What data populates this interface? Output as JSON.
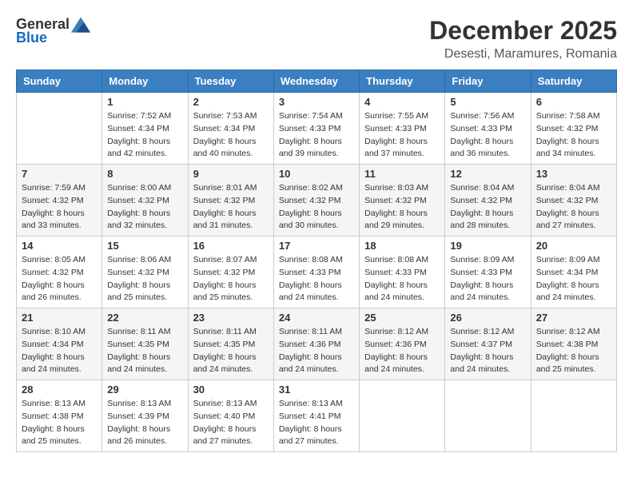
{
  "logo": {
    "text_general": "General",
    "text_blue": "Blue"
  },
  "title": "December 2025",
  "subtitle": "Desesti, Maramures, Romania",
  "header_color": "#3a7fc1",
  "days_of_week": [
    "Sunday",
    "Monday",
    "Tuesday",
    "Wednesday",
    "Thursday",
    "Friday",
    "Saturday"
  ],
  "weeks": [
    [
      {
        "day": "",
        "sunrise": "",
        "sunset": "",
        "daylight": ""
      },
      {
        "day": "1",
        "sunrise": "7:52 AM",
        "sunset": "4:34 PM",
        "daylight": "8 hours and 42 minutes."
      },
      {
        "day": "2",
        "sunrise": "7:53 AM",
        "sunset": "4:34 PM",
        "daylight": "8 hours and 40 minutes."
      },
      {
        "day": "3",
        "sunrise": "7:54 AM",
        "sunset": "4:33 PM",
        "daylight": "8 hours and 39 minutes."
      },
      {
        "day": "4",
        "sunrise": "7:55 AM",
        "sunset": "4:33 PM",
        "daylight": "8 hours and 37 minutes."
      },
      {
        "day": "5",
        "sunrise": "7:56 AM",
        "sunset": "4:33 PM",
        "daylight": "8 hours and 36 minutes."
      },
      {
        "day": "6",
        "sunrise": "7:58 AM",
        "sunset": "4:32 PM",
        "daylight": "8 hours and 34 minutes."
      }
    ],
    [
      {
        "day": "7",
        "sunrise": "7:59 AM",
        "sunset": "4:32 PM",
        "daylight": "8 hours and 33 minutes."
      },
      {
        "day": "8",
        "sunrise": "8:00 AM",
        "sunset": "4:32 PM",
        "daylight": "8 hours and 32 minutes."
      },
      {
        "day": "9",
        "sunrise": "8:01 AM",
        "sunset": "4:32 PM",
        "daylight": "8 hours and 31 minutes."
      },
      {
        "day": "10",
        "sunrise": "8:02 AM",
        "sunset": "4:32 PM",
        "daylight": "8 hours and 30 minutes."
      },
      {
        "day": "11",
        "sunrise": "8:03 AM",
        "sunset": "4:32 PM",
        "daylight": "8 hours and 29 minutes."
      },
      {
        "day": "12",
        "sunrise": "8:04 AM",
        "sunset": "4:32 PM",
        "daylight": "8 hours and 28 minutes."
      },
      {
        "day": "13",
        "sunrise": "8:04 AM",
        "sunset": "4:32 PM",
        "daylight": "8 hours and 27 minutes."
      }
    ],
    [
      {
        "day": "14",
        "sunrise": "8:05 AM",
        "sunset": "4:32 PM",
        "daylight": "8 hours and 26 minutes."
      },
      {
        "day": "15",
        "sunrise": "8:06 AM",
        "sunset": "4:32 PM",
        "daylight": "8 hours and 25 minutes."
      },
      {
        "day": "16",
        "sunrise": "8:07 AM",
        "sunset": "4:32 PM",
        "daylight": "8 hours and 25 minutes."
      },
      {
        "day": "17",
        "sunrise": "8:08 AM",
        "sunset": "4:33 PM",
        "daylight": "8 hours and 24 minutes."
      },
      {
        "day": "18",
        "sunrise": "8:08 AM",
        "sunset": "4:33 PM",
        "daylight": "8 hours and 24 minutes."
      },
      {
        "day": "19",
        "sunrise": "8:09 AM",
        "sunset": "4:33 PM",
        "daylight": "8 hours and 24 minutes."
      },
      {
        "day": "20",
        "sunrise": "8:09 AM",
        "sunset": "4:34 PM",
        "daylight": "8 hours and 24 minutes."
      }
    ],
    [
      {
        "day": "21",
        "sunrise": "8:10 AM",
        "sunset": "4:34 PM",
        "daylight": "8 hours and 24 minutes."
      },
      {
        "day": "22",
        "sunrise": "8:11 AM",
        "sunset": "4:35 PM",
        "daylight": "8 hours and 24 minutes."
      },
      {
        "day": "23",
        "sunrise": "8:11 AM",
        "sunset": "4:35 PM",
        "daylight": "8 hours and 24 minutes."
      },
      {
        "day": "24",
        "sunrise": "8:11 AM",
        "sunset": "4:36 PM",
        "daylight": "8 hours and 24 minutes."
      },
      {
        "day": "25",
        "sunrise": "8:12 AM",
        "sunset": "4:36 PM",
        "daylight": "8 hours and 24 minutes."
      },
      {
        "day": "26",
        "sunrise": "8:12 AM",
        "sunset": "4:37 PM",
        "daylight": "8 hours and 24 minutes."
      },
      {
        "day": "27",
        "sunrise": "8:12 AM",
        "sunset": "4:38 PM",
        "daylight": "8 hours and 25 minutes."
      }
    ],
    [
      {
        "day": "28",
        "sunrise": "8:13 AM",
        "sunset": "4:38 PM",
        "daylight": "8 hours and 25 minutes."
      },
      {
        "day": "29",
        "sunrise": "8:13 AM",
        "sunset": "4:39 PM",
        "daylight": "8 hours and 26 minutes."
      },
      {
        "day": "30",
        "sunrise": "8:13 AM",
        "sunset": "4:40 PM",
        "daylight": "8 hours and 27 minutes."
      },
      {
        "day": "31",
        "sunrise": "8:13 AM",
        "sunset": "4:41 PM",
        "daylight": "8 hours and 27 minutes."
      },
      {
        "day": "",
        "sunrise": "",
        "sunset": "",
        "daylight": ""
      },
      {
        "day": "",
        "sunrise": "",
        "sunset": "",
        "daylight": ""
      },
      {
        "day": "",
        "sunrise": "",
        "sunset": "",
        "daylight": ""
      }
    ]
  ]
}
